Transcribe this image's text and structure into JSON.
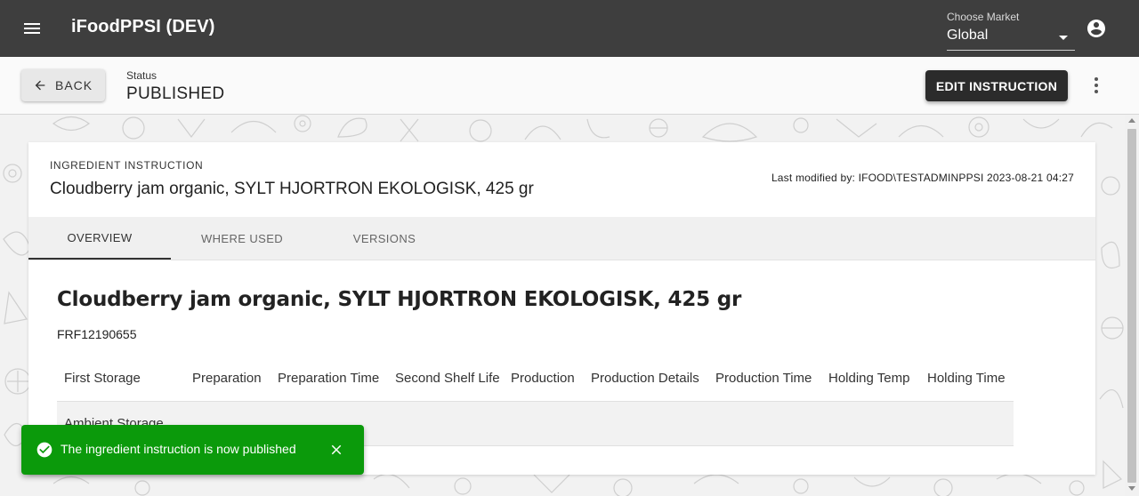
{
  "appbar": {
    "title": "iFoodPPSI (DEV)",
    "market_label": "Choose Market",
    "market_value": "Global"
  },
  "toolbar": {
    "back_label": "BACK",
    "status_label": "Status",
    "status_value": "PUBLISHED",
    "edit_label": "EDIT INSTRUCTION"
  },
  "card": {
    "overline": "INGREDIENT INSTRUCTION",
    "title": "Cloudberry jam organic, SYLT HJORTRON EKOLOGISK, 425 gr",
    "last_modified": "Last modified by: IFOOD\\TESTADMINPPSI 2023-08-21 04:27",
    "tabs": [
      {
        "label": "OVERVIEW",
        "active": true
      },
      {
        "label": "WHERE USED",
        "active": false
      },
      {
        "label": "VERSIONS",
        "active": false
      }
    ],
    "content_title": "Cloudberry jam organic, SYLT HJORTRON EKOLOGISK, 425 gr",
    "code": "FRF12190655",
    "table": {
      "headers": [
        "First Storage",
        "Preparation",
        "Preparation Time",
        "Second Shelf Life",
        "Production",
        "Production Details",
        "Production Time",
        "Holding Temp",
        "Holding Time"
      ],
      "rows": [
        [
          "Ambient Storage",
          "",
          "",
          "",
          "",
          "",
          "",
          "",
          ""
        ]
      ]
    }
  },
  "snackbar": {
    "message": "The ingredient instruction is now published"
  },
  "colors": {
    "appbar": "#3e3e3e",
    "success": "#0b9a0b",
    "primary_button": "#2b2b2b"
  }
}
